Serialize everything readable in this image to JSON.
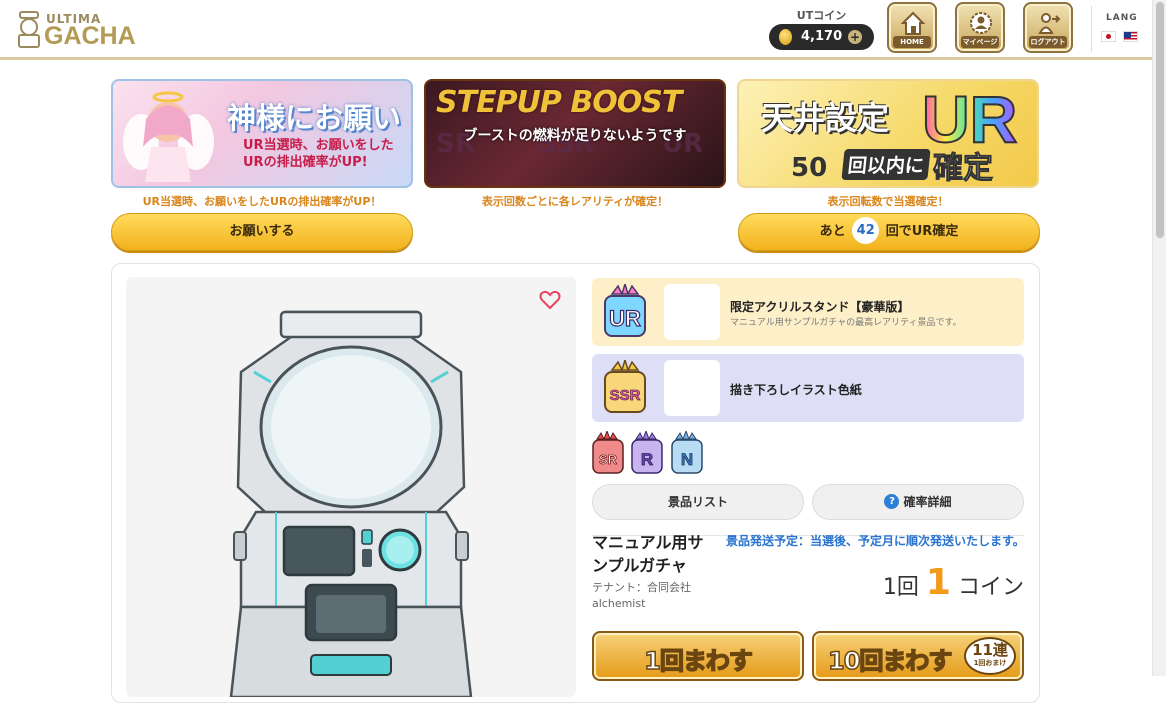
{
  "header": {
    "logo_top": "ULTIMA",
    "logo_main": "GACHA",
    "coin_title": "UTコイン",
    "coin_amount": "4,170",
    "coin_add": "+",
    "nav": {
      "home": "HOME",
      "mypage": "マイページ",
      "logout": "ログアウト"
    },
    "lang_title": "LANG"
  },
  "banners": {
    "wish": {
      "title": "神様にお願い",
      "subtitle": "UR当選時、お願いをしたURの排出確率がUP!",
      "caption": "UR当選時、お願いをしたURの排出確率がUP！",
      "button": "お願いする"
    },
    "stepup": {
      "title": "STEPUP BOOST",
      "rarities": [
        "SR",
        "SSR",
        "UR"
      ],
      "message": "ブーストの燃料が足りないようです",
      "caption": "表示回数ごとに各レアリティが確定！"
    },
    "ceiling": {
      "title": "天井設定",
      "ur": "UR",
      "count": "50",
      "within": "回以内に",
      "confirm": "確定",
      "caption": "表示回転数で当選確定！",
      "button_pre": "あと",
      "button_count": "42",
      "button_post": "回でUR確定"
    }
  },
  "prizes": [
    {
      "rarity": "UR",
      "name": "限定アクリルスタンド【豪華版】",
      "description": "マニュアル用サンプルガチャの最高レアリティ景品です。"
    },
    {
      "rarity": "SSR",
      "name": "描き下ろしイラスト色紙",
      "description": ""
    }
  ],
  "other_rarities": [
    "SR",
    "R",
    "N"
  ],
  "tabs": {
    "prize_list": "景品リスト",
    "probability_icon": "?",
    "probability": "確率詳細"
  },
  "gacha": {
    "name": "マニュアル用サンプルガチャ",
    "tenant": "テナント：合同会社alchemist",
    "shipping": "景品発送予定：当選後、予定月に順次発送いたします。",
    "price_prefix": "1回",
    "price_value": "1",
    "price_suffix": "コイン"
  },
  "spin": {
    "single": "1回まわす",
    "ten": "10回まわす",
    "bonus_main": "11連",
    "bonus_sub": "1回おまけ"
  }
}
